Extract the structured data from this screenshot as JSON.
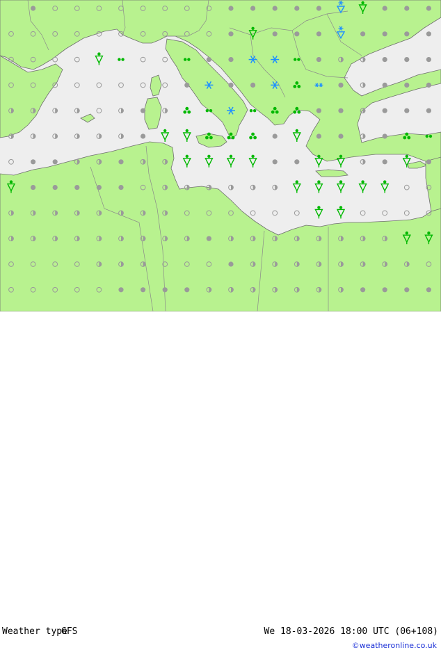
{
  "header": {
    "map_kind": "Weather type",
    "model": "GFS",
    "valid_time": "We 18-03-2026 18:00 UTC (06+108)",
    "credit": "©weatheronline.co.uk"
  },
  "colors": {
    "land": "#b8f28f",
    "sea": "#eeeeee",
    "border": "#8a8a8a",
    "coast": "#6f6f6f",
    "dry_symbol": "#9a9a9a",
    "rain_symbol": "#00b800",
    "snow_symbol": "#1e90ff",
    "credit_link": "#1a2fd6"
  },
  "symbols": [
    {
      "col": 1,
      "row": 0,
      "type": "dot"
    },
    {
      "col": 2,
      "row": 0,
      "type": "circle"
    },
    {
      "col": 3,
      "row": 0,
      "type": "circle"
    },
    {
      "col": 4,
      "row": 0,
      "type": "circle"
    },
    {
      "col": 5,
      "row": 0,
      "type": "circle"
    },
    {
      "col": 6,
      "row": 0,
      "type": "circle"
    },
    {
      "col": 7,
      "row": 0,
      "type": "circle"
    },
    {
      "col": 8,
      "row": 0,
      "type": "circle"
    },
    {
      "col": 9,
      "row": 0,
      "type": "circle"
    },
    {
      "col": 10,
      "row": 0,
      "type": "dot"
    },
    {
      "col": 11,
      "row": 0,
      "type": "dot"
    },
    {
      "col": 12,
      "row": 0,
      "type": "dot"
    },
    {
      "col": 13,
      "row": 0,
      "type": "dot"
    },
    {
      "col": 14,
      "row": 0,
      "type": "dot"
    },
    {
      "col": 15,
      "row": 0,
      "type": "snow_shower"
    },
    {
      "col": 16,
      "row": 0,
      "type": "rain_shower"
    },
    {
      "col": 17,
      "row": 0,
      "type": "dot"
    },
    {
      "col": 18,
      "row": 0,
      "type": "dot"
    },
    {
      "col": 19,
      "row": 0,
      "type": "dot"
    },
    {
      "col": 0,
      "row": 1,
      "type": "circle"
    },
    {
      "col": 1,
      "row": 1,
      "type": "circle"
    },
    {
      "col": 2,
      "row": 1,
      "type": "circle"
    },
    {
      "col": 3,
      "row": 1,
      "type": "circle"
    },
    {
      "col": 4,
      "row": 1,
      "type": "circle"
    },
    {
      "col": 5,
      "row": 1,
      "type": "circle"
    },
    {
      "col": 6,
      "row": 1,
      "type": "circle"
    },
    {
      "col": 7,
      "row": 1,
      "type": "circle"
    },
    {
      "col": 8,
      "row": 1,
      "type": "circle"
    },
    {
      "col": 9,
      "row": 1,
      "type": "circle"
    },
    {
      "col": 10,
      "row": 1,
      "type": "dot"
    },
    {
      "col": 11,
      "row": 1,
      "type": "rain_shower"
    },
    {
      "col": 12,
      "row": 1,
      "type": "dot"
    },
    {
      "col": 13,
      "row": 1,
      "type": "dot"
    },
    {
      "col": 14,
      "row": 1,
      "type": "dot"
    },
    {
      "col": 15,
      "row": 1,
      "type": "snow_shower"
    },
    {
      "col": 16,
      "row": 1,
      "type": "dot"
    },
    {
      "col": 17,
      "row": 1,
      "type": "dot"
    },
    {
      "col": 18,
      "row": 1,
      "type": "dot"
    },
    {
      "col": 19,
      "row": 1,
      "type": "dot"
    },
    {
      "col": 0,
      "row": 2,
      "type": "circle"
    },
    {
      "col": 1,
      "row": 2,
      "type": "circle"
    },
    {
      "col": 2,
      "row": 2,
      "type": "circle"
    },
    {
      "col": 3,
      "row": 2,
      "type": "circle"
    },
    {
      "col": 4,
      "row": 2,
      "type": "rain_shower"
    },
    {
      "col": 5,
      "row": 2,
      "type": "drizzle"
    },
    {
      "col": 6,
      "row": 2,
      "type": "circle"
    },
    {
      "col": 7,
      "row": 2,
      "type": "circle"
    },
    {
      "col": 8,
      "row": 2,
      "type": "drizzle"
    },
    {
      "col": 9,
      "row": 2,
      "type": "dot"
    },
    {
      "col": 10,
      "row": 2,
      "type": "dot"
    },
    {
      "col": 11,
      "row": 2,
      "type": "snow"
    },
    {
      "col": 12,
      "row": 2,
      "type": "snow"
    },
    {
      "col": 13,
      "row": 2,
      "type": "drizzle"
    },
    {
      "col": 14,
      "row": 2,
      "type": "dot"
    },
    {
      "col": 15,
      "row": 2,
      "type": "half"
    },
    {
      "col": 16,
      "row": 2,
      "type": "half"
    },
    {
      "col": 17,
      "row": 2,
      "type": "dot"
    },
    {
      "col": 18,
      "row": 2,
      "type": "dot"
    },
    {
      "col": 19,
      "row": 2,
      "type": "dot"
    },
    {
      "col": 0,
      "row": 3,
      "type": "circle"
    },
    {
      "col": 1,
      "row": 3,
      "type": "circle"
    },
    {
      "col": 2,
      "row": 3,
      "type": "circle"
    },
    {
      "col": 3,
      "row": 3,
      "type": "circle"
    },
    {
      "col": 4,
      "row": 3,
      "type": "circle"
    },
    {
      "col": 5,
      "row": 3,
      "type": "circle"
    },
    {
      "col": 6,
      "row": 3,
      "type": "circle"
    },
    {
      "col": 7,
      "row": 3,
      "type": "circle"
    },
    {
      "col": 8,
      "row": 3,
      "type": "dot"
    },
    {
      "col": 9,
      "row": 3,
      "type": "snow"
    },
    {
      "col": 10,
      "row": 3,
      "type": "dot"
    },
    {
      "col": 11,
      "row": 3,
      "type": "dot"
    },
    {
      "col": 12,
      "row": 3,
      "type": "snow"
    },
    {
      "col": 13,
      "row": 3,
      "type": "rain"
    },
    {
      "col": 14,
      "row": 3,
      "type": "snow_light"
    },
    {
      "col": 15,
      "row": 3,
      "type": "dot"
    },
    {
      "col": 16,
      "row": 3,
      "type": "half"
    },
    {
      "col": 17,
      "row": 3,
      "type": "dot"
    },
    {
      "col": 18,
      "row": 3,
      "type": "dot"
    },
    {
      "col": 19,
      "row": 3,
      "type": "dot"
    },
    {
      "col": 0,
      "row": 4,
      "type": "half"
    },
    {
      "col": 1,
      "row": 4,
      "type": "half"
    },
    {
      "col": 2,
      "row": 4,
      "type": "half"
    },
    {
      "col": 3,
      "row": 4,
      "type": "half"
    },
    {
      "col": 4,
      "row": 4,
      "type": "circle"
    },
    {
      "col": 5,
      "row": 4,
      "type": "half"
    },
    {
      "col": 6,
      "row": 4,
      "type": "dot"
    },
    {
      "col": 7,
      "row": 4,
      "type": "half"
    },
    {
      "col": 8,
      "row": 4,
      "type": "rain"
    },
    {
      "col": 9,
      "row": 4,
      "type": "drizzle"
    },
    {
      "col": 10,
      "row": 4,
      "type": "snow"
    },
    {
      "col": 11,
      "row": 4,
      "type": "drizzle"
    },
    {
      "col": 12,
      "row": 4,
      "type": "rain"
    },
    {
      "col": 13,
      "row": 4,
      "type": "rain"
    },
    {
      "col": 14,
      "row": 4,
      "type": "dot"
    },
    {
      "col": 15,
      "row": 4,
      "type": "dot"
    },
    {
      "col": 16,
      "row": 4,
      "type": "half"
    },
    {
      "col": 17,
      "row": 4,
      "type": "dot"
    },
    {
      "col": 18,
      "row": 4,
      "type": "dot"
    },
    {
      "col": 19,
      "row": 4,
      "type": "dot"
    },
    {
      "col": 0,
      "row": 5,
      "type": "half"
    },
    {
      "col": 1,
      "row": 5,
      "type": "half"
    },
    {
      "col": 2,
      "row": 5,
      "type": "half"
    },
    {
      "col": 3,
      "row": 5,
      "type": "half"
    },
    {
      "col": 4,
      "row": 5,
      "type": "half"
    },
    {
      "col": 5,
      "row": 5,
      "type": "half"
    },
    {
      "col": 6,
      "row": 5,
      "type": "dot"
    },
    {
      "col": 7,
      "row": 5,
      "type": "rain_shower"
    },
    {
      "col": 8,
      "row": 5,
      "type": "rain_shower"
    },
    {
      "col": 9,
      "row": 5,
      "type": "rain"
    },
    {
      "col": 10,
      "row": 5,
      "type": "rain"
    },
    {
      "col": 11,
      "row": 5,
      "type": "rain"
    },
    {
      "col": 12,
      "row": 5,
      "type": "dot"
    },
    {
      "col": 13,
      "row": 5,
      "type": "rain_shower"
    },
    {
      "col": 14,
      "row": 5,
      "type": "dot"
    },
    {
      "col": 15,
      "row": 5,
      "type": "dot"
    },
    {
      "col": 16,
      "row": 5,
      "type": "half"
    },
    {
      "col": 17,
      "row": 5,
      "type": "dot"
    },
    {
      "col": 18,
      "row": 5,
      "type": "rain"
    },
    {
      "col": 19,
      "row": 5,
      "type": "drizzle"
    },
    {
      "col": 0,
      "row": 6,
      "type": "circle"
    },
    {
      "col": 1,
      "row": 6,
      "type": "dot"
    },
    {
      "col": 2,
      "row": 6,
      "type": "dot"
    },
    {
      "col": 3,
      "row": 6,
      "type": "half"
    },
    {
      "col": 4,
      "row": 6,
      "type": "half"
    },
    {
      "col": 5,
      "row": 6,
      "type": "dot"
    },
    {
      "col": 6,
      "row": 6,
      "type": "half"
    },
    {
      "col": 7,
      "row": 6,
      "type": "half"
    },
    {
      "col": 8,
      "row": 6,
      "type": "rain_shower"
    },
    {
      "col": 9,
      "row": 6,
      "type": "rain_shower"
    },
    {
      "col": 10,
      "row": 6,
      "type": "rain_shower"
    },
    {
      "col": 11,
      "row": 6,
      "type": "rain_shower"
    },
    {
      "col": 12,
      "row": 6,
      "type": "dot"
    },
    {
      "col": 13,
      "row": 6,
      "type": "dot"
    },
    {
      "col": 14,
      "row": 6,
      "type": "rain_shower"
    },
    {
      "col": 15,
      "row": 6,
      "type": "rain_shower"
    },
    {
      "col": 16,
      "row": 6,
      "type": "half"
    },
    {
      "col": 17,
      "row": 6,
      "type": "dot"
    },
    {
      "col": 18,
      "row": 6,
      "type": "rain_shower"
    },
    {
      "col": 19,
      "row": 6,
      "type": "dot"
    },
    {
      "col": 0,
      "row": 7,
      "type": "rain_shower"
    },
    {
      "col": 1,
      "row": 7,
      "type": "dot"
    },
    {
      "col": 2,
      "row": 7,
      "type": "dot"
    },
    {
      "col": 3,
      "row": 7,
      "type": "dot"
    },
    {
      "col": 4,
      "row": 7,
      "type": "dot"
    },
    {
      "col": 5,
      "row": 7,
      "type": "dot"
    },
    {
      "col": 6,
      "row": 7,
      "type": "circle"
    },
    {
      "col": 7,
      "row": 7,
      "type": "half"
    },
    {
      "col": 8,
      "row": 7,
      "type": "half"
    },
    {
      "col": 9,
      "row": 7,
      "type": "half"
    },
    {
      "col": 10,
      "row": 7,
      "type": "half"
    },
    {
      "col": 11,
      "row": 7,
      "type": "half"
    },
    {
      "col": 12,
      "row": 7,
      "type": "half"
    },
    {
      "col": 13,
      "row": 7,
      "type": "rain_shower"
    },
    {
      "col": 14,
      "row": 7,
      "type": "rain_shower"
    },
    {
      "col": 15,
      "row": 7,
      "type": "rain_shower"
    },
    {
      "col": 16,
      "row": 7,
      "type": "rain_shower"
    },
    {
      "col": 17,
      "row": 7,
      "type": "rain_shower"
    },
    {
      "col": 18,
      "row": 7,
      "type": "circle"
    },
    {
      "col": 19,
      "row": 7,
      "type": "circle"
    },
    {
      "col": 0,
      "row": 8,
      "type": "half"
    },
    {
      "col": 1,
      "row": 8,
      "type": "half"
    },
    {
      "col": 2,
      "row": 8,
      "type": "half"
    },
    {
      "col": 3,
      "row": 8,
      "type": "half"
    },
    {
      "col": 4,
      "row": 8,
      "type": "half"
    },
    {
      "col": 5,
      "row": 8,
      "type": "half"
    },
    {
      "col": 6,
      "row": 8,
      "type": "half"
    },
    {
      "col": 7,
      "row": 8,
      "type": "half"
    },
    {
      "col": 8,
      "row": 8,
      "type": "circle"
    },
    {
      "col": 9,
      "row": 8,
      "type": "circle"
    },
    {
      "col": 10,
      "row": 8,
      "type": "circle"
    },
    {
      "col": 11,
      "row": 8,
      "type": "circle"
    },
    {
      "col": 12,
      "row": 8,
      "type": "circle"
    },
    {
      "col": 13,
      "row": 8,
      "type": "circle"
    },
    {
      "col": 14,
      "row": 8,
      "type": "rain_shower"
    },
    {
      "col": 15,
      "row": 8,
      "type": "rain_shower"
    },
    {
      "col": 16,
      "row": 8,
      "type": "circle"
    },
    {
      "col": 17,
      "row": 8,
      "type": "circle"
    },
    {
      "col": 18,
      "row": 8,
      "type": "circle"
    },
    {
      "col": 19,
      "row": 8,
      "type": "circle"
    },
    {
      "col": 0,
      "row": 9,
      "type": "half"
    },
    {
      "col": 1,
      "row": 9,
      "type": "half"
    },
    {
      "col": 2,
      "row": 9,
      "type": "half"
    },
    {
      "col": 3,
      "row": 9,
      "type": "half"
    },
    {
      "col": 4,
      "row": 9,
      "type": "half"
    },
    {
      "col": 5,
      "row": 9,
      "type": "half"
    },
    {
      "col": 6,
      "row": 9,
      "type": "half"
    },
    {
      "col": 7,
      "row": 9,
      "type": "half"
    },
    {
      "col": 8,
      "row": 9,
      "type": "half"
    },
    {
      "col": 9,
      "row": 9,
      "type": "dot"
    },
    {
      "col": 10,
      "row": 9,
      "type": "half"
    },
    {
      "col": 11,
      "row": 9,
      "type": "half"
    },
    {
      "col": 12,
      "row": 9,
      "type": "half"
    },
    {
      "col": 13,
      "row": 9,
      "type": "half"
    },
    {
      "col": 14,
      "row": 9,
      "type": "half"
    },
    {
      "col": 15,
      "row": 9,
      "type": "half"
    },
    {
      "col": 16,
      "row": 9,
      "type": "half"
    },
    {
      "col": 17,
      "row": 9,
      "type": "half"
    },
    {
      "col": 18,
      "row": 9,
      "type": "rain_shower"
    },
    {
      "col": 19,
      "row": 9,
      "type": "rain_shower"
    },
    {
      "col": 0,
      "row": 10,
      "type": "circle"
    },
    {
      "col": 1,
      "row": 10,
      "type": "circle"
    },
    {
      "col": 2,
      "row": 10,
      "type": "circle"
    },
    {
      "col": 3,
      "row": 10,
      "type": "circle"
    },
    {
      "col": 4,
      "row": 10,
      "type": "half"
    },
    {
      "col": 5,
      "row": 10,
      "type": "half"
    },
    {
      "col": 6,
      "row": 10,
      "type": "half"
    },
    {
      "col": 7,
      "row": 10,
      "type": "circle"
    },
    {
      "col": 8,
      "row": 10,
      "type": "circle"
    },
    {
      "col": 9,
      "row": 10,
      "type": "circle"
    },
    {
      "col": 10,
      "row": 10,
      "type": "dot"
    },
    {
      "col": 11,
      "row": 10,
      "type": "half"
    },
    {
      "col": 12,
      "row": 10,
      "type": "half"
    },
    {
      "col": 13,
      "row": 10,
      "type": "half"
    },
    {
      "col": 14,
      "row": 10,
      "type": "half"
    },
    {
      "col": 15,
      "row": 10,
      "type": "half"
    },
    {
      "col": 16,
      "row": 10,
      "type": "half"
    },
    {
      "col": 17,
      "row": 10,
      "type": "half"
    },
    {
      "col": 18,
      "row": 10,
      "type": "half"
    },
    {
      "col": 19,
      "row": 10,
      "type": "circle"
    },
    {
      "col": 0,
      "row": 11,
      "type": "circle"
    },
    {
      "col": 1,
      "row": 11,
      "type": "circle"
    },
    {
      "col": 2,
      "row": 11,
      "type": "circle"
    },
    {
      "col": 3,
      "row": 11,
      "type": "circle"
    },
    {
      "col": 4,
      "row": 11,
      "type": "circle"
    },
    {
      "col": 5,
      "row": 11,
      "type": "dot"
    },
    {
      "col": 6,
      "row": 11,
      "type": "dot"
    },
    {
      "col": 7,
      "row": 11,
      "type": "dot"
    },
    {
      "col": 8,
      "row": 11,
      "type": "dot"
    },
    {
      "col": 9,
      "row": 11,
      "type": "half"
    },
    {
      "col": 10,
      "row": 11,
      "type": "half"
    },
    {
      "col": 11,
      "row": 11,
      "type": "half"
    },
    {
      "col": 12,
      "row": 11,
      "type": "half"
    },
    {
      "col": 13,
      "row": 11,
      "type": "half"
    },
    {
      "col": 14,
      "row": 11,
      "type": "half"
    },
    {
      "col": 15,
      "row": 11,
      "type": "half"
    },
    {
      "col": 16,
      "row": 11,
      "type": "dot"
    },
    {
      "col": 17,
      "row": 11,
      "type": "dot"
    },
    {
      "col": 18,
      "row": 11,
      "type": "dot"
    },
    {
      "col": 19,
      "row": 11,
      "type": "dot"
    }
  ]
}
